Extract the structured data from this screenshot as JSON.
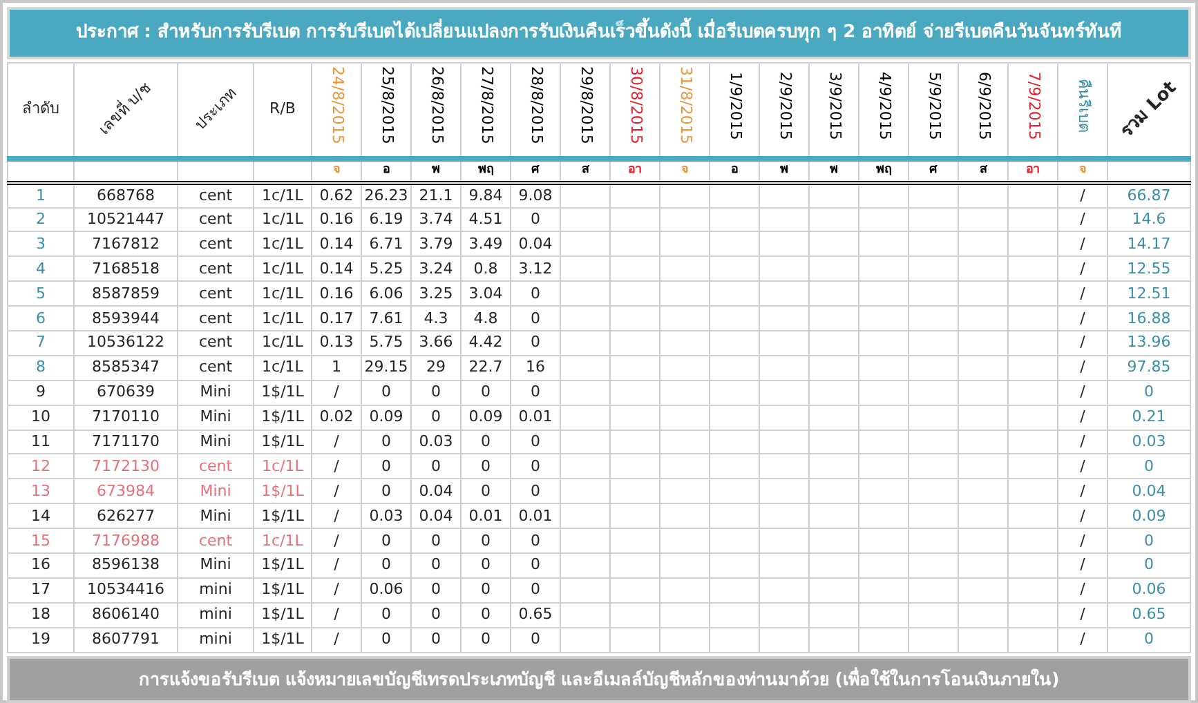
{
  "banner": "ประกาศ : สำหรับการรับรีเบต  การรับรีเบตได้เปลี่ยนแปลงการรับเงินคืนเร็วขึ้นดังนี้   เมื่อรีเบตครบทุก ๆ 2 อาทิตย์ จ่ายรีเบตคืนวันจันทร์ทันที",
  "columns": [
    {
      "label": "ลำดับ",
      "kind": "plain"
    },
    {
      "label": "เลขที่ บ/ช",
      "kind": "diagonal"
    },
    {
      "label": "ประเภท",
      "kind": "diagonal"
    },
    {
      "label": "R/B",
      "kind": "plain"
    },
    {
      "label": "24/8/2015",
      "kind": "date",
      "color": "#e8963c",
      "day": {
        "label": "จ",
        "color": "#e8963c"
      }
    },
    {
      "label": "25/8/2015",
      "kind": "date",
      "color": "#000000",
      "day": {
        "label": "อ",
        "color": "#000000"
      }
    },
    {
      "label": "26/8/2015",
      "kind": "date",
      "color": "#000000",
      "day": {
        "label": "พ",
        "color": "#000000"
      }
    },
    {
      "label": "27/8/2015",
      "kind": "date",
      "color": "#000000",
      "day": {
        "label": "พฤ",
        "color": "#000000"
      }
    },
    {
      "label": "28/8/2015",
      "kind": "date",
      "color": "#000000",
      "day": {
        "label": "ศ",
        "color": "#000000"
      }
    },
    {
      "label": "29/8/2015",
      "kind": "date",
      "color": "#000000",
      "day": {
        "label": "ส",
        "color": "#000000"
      }
    },
    {
      "label": "30/8/2015",
      "kind": "date",
      "color": "#e0202a",
      "day": {
        "label": "อา",
        "color": "#e0202a"
      }
    },
    {
      "label": "31/8/2015",
      "kind": "date",
      "color": "#e8963c",
      "day": {
        "label": "จ",
        "color": "#e8963c"
      }
    },
    {
      "label": "1/9/2015",
      "kind": "date",
      "color": "#000000",
      "day": {
        "label": "อ",
        "color": "#000000"
      }
    },
    {
      "label": "2/9/2015",
      "kind": "date",
      "color": "#000000",
      "day": {
        "label": "พ",
        "color": "#000000"
      }
    },
    {
      "label": "3/9/2015",
      "kind": "date",
      "color": "#000000",
      "day": {
        "label": "พ",
        "color": "#000000"
      }
    },
    {
      "label": "4/9/2015",
      "kind": "date",
      "color": "#000000",
      "day": {
        "label": "พฤ",
        "color": "#000000"
      }
    },
    {
      "label": "5/9/2015",
      "kind": "date",
      "color": "#000000",
      "day": {
        "label": "ศ",
        "color": "#000000"
      }
    },
    {
      "label": "6/9/2015",
      "kind": "date",
      "color": "#000000",
      "day": {
        "label": "ส",
        "color": "#000000"
      }
    },
    {
      "label": "7/9/2015",
      "kind": "date",
      "color": "#e0202a",
      "day": {
        "label": "อา",
        "color": "#e0202a"
      }
    },
    {
      "label": "คืนรีเบต",
      "kind": "date",
      "color": "#3a8fa8",
      "day": {
        "label": "จ",
        "color": "#e8963c"
      }
    },
    {
      "label": "รวม Lot",
      "kind": "diagonal"
    }
  ],
  "rows": [
    {
      "no": "1",
      "account": "668768",
      "type": "cent",
      "rb": "1c/1L",
      "daily": [
        "0.62",
        "26.23",
        "21.1",
        "9.84",
        "9.08"
      ],
      "refund": "/",
      "total": "66.87",
      "flagged": false
    },
    {
      "no": "2",
      "account": "10521447",
      "type": "cent",
      "rb": "1c/1L",
      "daily": [
        "0.16",
        "6.19",
        "3.74",
        "4.51",
        "0"
      ],
      "refund": "/",
      "total": "14.6",
      "flagged": false
    },
    {
      "no": "3",
      "account": "7167812",
      "type": "cent",
      "rb": "1c/1L",
      "daily": [
        "0.14",
        "6.71",
        "3.79",
        "3.49",
        "0.04"
      ],
      "refund": "/",
      "total": "14.17",
      "flagged": false
    },
    {
      "no": "4",
      "account": "7168518",
      "type": "cent",
      "rb": "1c/1L",
      "daily": [
        "0.14",
        "5.25",
        "3.24",
        "0.8",
        "3.12"
      ],
      "refund": "/",
      "total": "12.55",
      "flagged": false
    },
    {
      "no": "5",
      "account": "8587859",
      "type": "cent",
      "rb": "1c/1L",
      "daily": [
        "0.16",
        "6.06",
        "3.25",
        "3.04",
        "0"
      ],
      "refund": "/",
      "total": "12.51",
      "flagged": false
    },
    {
      "no": "6",
      "account": "8593944",
      "type": "cent",
      "rb": "1c/1L",
      "daily": [
        "0.17",
        "7.61",
        "4.3",
        "4.8",
        "0"
      ],
      "refund": "/",
      "total": "16.88",
      "flagged": false
    },
    {
      "no": "7",
      "account": "10536122",
      "type": "cent",
      "rb": "1c/1L",
      "daily": [
        "0.13",
        "5.75",
        "3.66",
        "4.42",
        "0"
      ],
      "refund": "/",
      "total": "13.96",
      "flagged": false
    },
    {
      "no": "8",
      "account": "8585347",
      "type": "cent",
      "rb": "1c/1L",
      "daily": [
        "1",
        "29.15",
        "29",
        "22.7",
        "16"
      ],
      "refund": "/",
      "total": "97.85",
      "flagged": false
    },
    {
      "no": "9",
      "account": "670639",
      "type": "Mini",
      "rb": "1$/1L",
      "daily": [
        "/",
        "0",
        "0",
        "0",
        "0"
      ],
      "refund": "/",
      "total": "0",
      "flagged": false
    },
    {
      "no": "10",
      "account": "7170110",
      "type": "Mini",
      "rb": "1$/1L",
      "daily": [
        "0.02",
        "0.09",
        "0",
        "0.09",
        "0.01"
      ],
      "refund": "/",
      "total": "0.21",
      "flagged": false
    },
    {
      "no": "11",
      "account": "7171170",
      "type": "Mini",
      "rb": "1$/1L",
      "daily": [
        "/",
        "0",
        "0.03",
        "0",
        "0"
      ],
      "refund": "/",
      "total": "0.03",
      "flagged": false
    },
    {
      "no": "12",
      "account": "7172130",
      "type": "cent",
      "rb": "1c/1L",
      "daily": [
        "/",
        "0",
        "0",
        "0",
        "0"
      ],
      "refund": "/",
      "total": "0",
      "flagged": true
    },
    {
      "no": "13",
      "account": "673984",
      "type": "Mini",
      "rb": "1$/1L",
      "daily": [
        "/",
        "0",
        "0.04",
        "0",
        "0"
      ],
      "refund": "/",
      "total": "0.04",
      "flagged": true
    },
    {
      "no": "14",
      "account": "626277",
      "type": "Mini",
      "rb": "1$/1L",
      "daily": [
        "/",
        "0.03",
        "0.04",
        "0.01",
        "0.01"
      ],
      "refund": "/",
      "total": "0.09",
      "flagged": false
    },
    {
      "no": "15",
      "account": "7176988",
      "type": "cent",
      "rb": "1c/1L",
      "daily": [
        "/",
        "0",
        "0",
        "0",
        "0"
      ],
      "refund": "/",
      "total": "0",
      "flagged": true
    },
    {
      "no": "16",
      "account": "8596138",
      "type": "Mini",
      "rb": "1$/1L",
      "daily": [
        "/",
        "0",
        "0",
        "0",
        "0"
      ],
      "refund": "/",
      "total": "0",
      "flagged": false
    },
    {
      "no": "17",
      "account": "10534416",
      "type": "mini",
      "rb": "1$/1L",
      "daily": [
        "/",
        "0.06",
        "0",
        "0",
        "0"
      ],
      "refund": "/",
      "total": "0.06",
      "flagged": false
    },
    {
      "no": "18",
      "account": "8606140",
      "type": "mini",
      "rb": "1$/1L",
      "daily": [
        "/",
        "0",
        "0",
        "0",
        "0.65"
      ],
      "refund": "/",
      "total": "0.65",
      "flagged": false
    },
    {
      "no": "19",
      "account": "8607791",
      "type": "mini",
      "rb": "1$/1L",
      "daily": [
        "/",
        "0",
        "0",
        "0",
        "0"
      ],
      "refund": "/",
      "total": "0",
      "flagged": false
    }
  ],
  "footer": "การแจ้งขอรับรีเบต   แจ้งหมายเลขบัญชีเทรดประเภทบัญชี และอีเมลล์บัญชีหลักของท่านมาด้วย   (เพื่อใช้ในการโอนเงินภายใน)"
}
